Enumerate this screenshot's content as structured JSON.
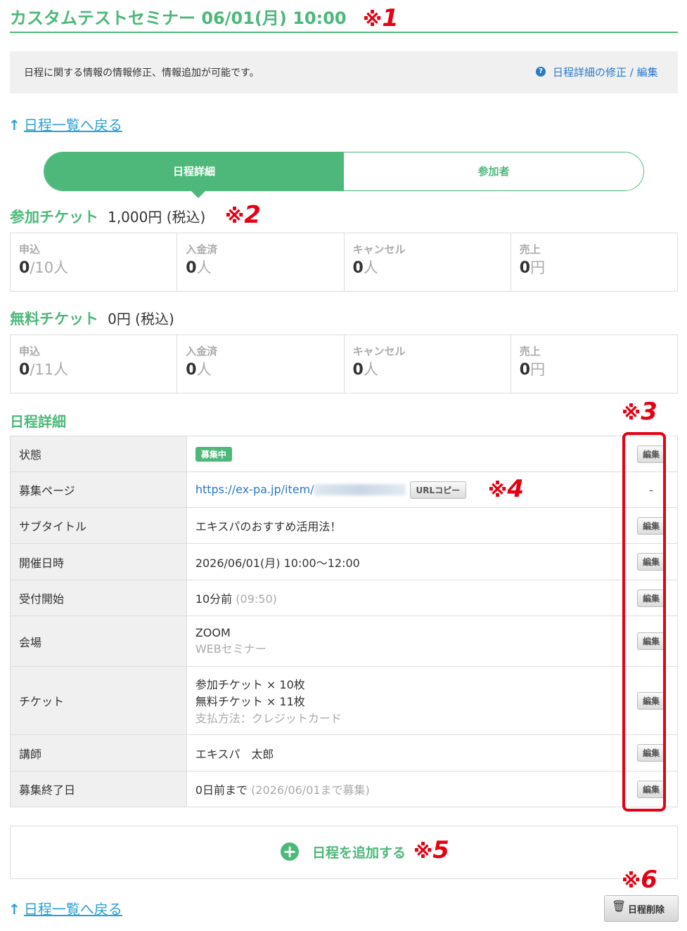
{
  "page": {
    "title": "カスタムテストセミナー 06/01(月) 10:00",
    "info_text": "日程に関する情報の情報修正、情報追加が可能です。",
    "help_icon_glyph": "?",
    "help_link": "日程詳細の修正 / 編集",
    "back_link": "日程一覧へ戻る",
    "back_arrow_glyph": "↑"
  },
  "tabs": [
    {
      "label": "日程詳細",
      "active": true
    },
    {
      "label": "参加者",
      "active": false
    }
  ],
  "tickets": [
    {
      "name": "参加チケット",
      "price": "1,000円 (税込)",
      "stats": {
        "applied_label": "申込",
        "applied_value": "0",
        "applied_unit": "/10人",
        "paid_label": "入金済",
        "paid_value": "0",
        "paid_unit": "人",
        "cancel_label": "キャンセル",
        "cancel_value": "0",
        "cancel_unit": "人",
        "sales_label": "売上",
        "sales_value": "0",
        "sales_unit": "円"
      }
    },
    {
      "name": "無料チケット",
      "price": "0円 (税込)",
      "stats": {
        "applied_label": "申込",
        "applied_value": "0",
        "applied_unit": "/11人",
        "paid_label": "入金済",
        "paid_value": "0",
        "paid_unit": "人",
        "cancel_label": "キャンセル",
        "cancel_value": "0",
        "cancel_unit": "人",
        "sales_label": "売上",
        "sales_value": "0",
        "sales_unit": "円"
      }
    }
  ],
  "schedule": {
    "title": "日程詳細",
    "edit_label": "編集",
    "rows": {
      "status": {
        "label": "状態",
        "badge": "募集中"
      },
      "page": {
        "label": "募集ページ",
        "url": "https://ex-pa.jp/item/",
        "copy_label": "URLコピー",
        "action": "-"
      },
      "subtitle": {
        "label": "サブタイトル",
        "value": "エキスパのおすすめ活用法！"
      },
      "datetime": {
        "label": "開催日時",
        "value": "2026/06/01(月) 10:00〜12:00"
      },
      "reception": {
        "label": "受付開始",
        "value": "10分前",
        "note": "(09:50)"
      },
      "venue": {
        "label": "会場",
        "value": "ZOOM",
        "note": "WEBセミナー"
      },
      "ticket": {
        "label": "チケット",
        "line1": "参加チケット × 10枚",
        "line2": "無料チケット × 11枚",
        "note": "支払方法：クレジットカード"
      },
      "teacher": {
        "label": "講師",
        "value": "エキスパ　太郎"
      },
      "deadline": {
        "label": "募集終了日",
        "value": "0日前まで",
        "note": "(2026/06/01まで募集)"
      }
    }
  },
  "add_schedule": {
    "icon_glyph": "+",
    "label": "日程を追加する"
  },
  "delete_button": {
    "icon_glyph": "🗑",
    "label": "日程削除"
  },
  "annotations": {
    "m1": {
      "k": "※",
      "n": "1"
    },
    "m2": {
      "k": "※",
      "n": "2"
    },
    "m3": {
      "k": "※",
      "n": "3"
    },
    "m4": {
      "k": "※",
      "n": "4"
    },
    "m5": {
      "k": "※",
      "n": "5"
    },
    "m6": {
      "k": "※",
      "n": "6"
    }
  },
  "colors": {
    "accent": "#4db87a",
    "link": "#2a78c8",
    "annotation": "#e60012"
  }
}
